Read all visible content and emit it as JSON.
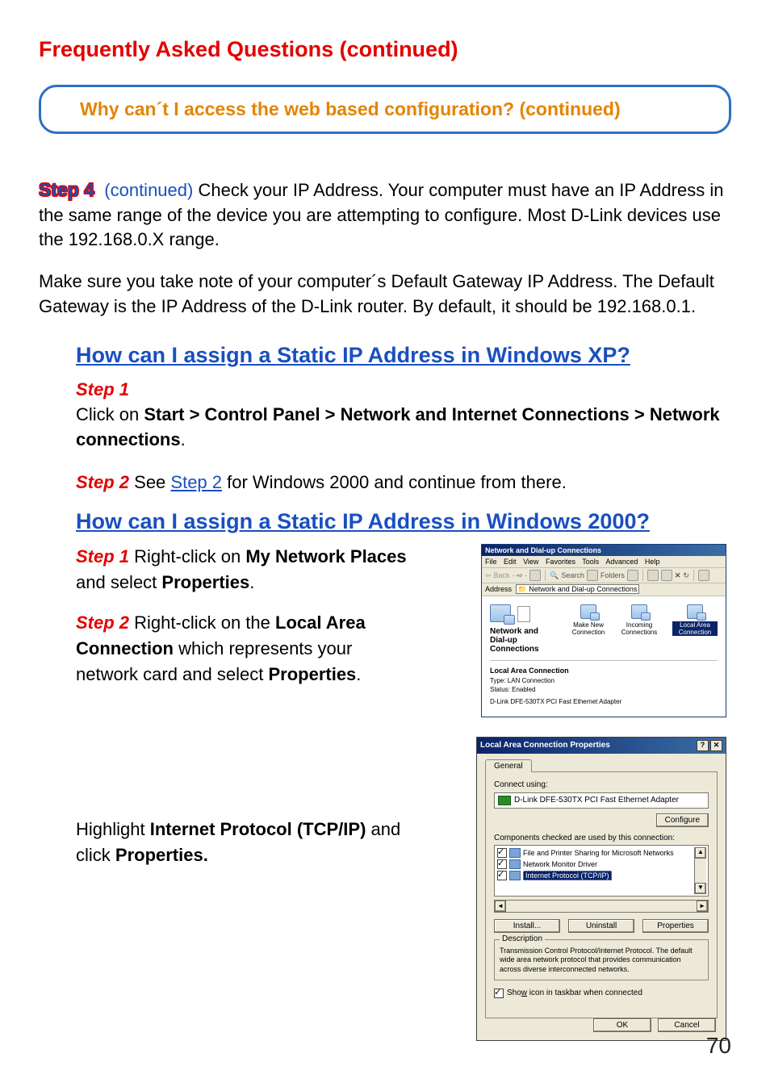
{
  "pageTitle": "Frequently Asked Questions (continued)",
  "questionBox": "Why can´t I access the web based configuration? (continued)",
  "step4": {
    "label": "Step 4",
    "continued": "(continued)",
    "text": " Check your IP Address. Your computer must have an IP Address in the same range of the device you are attempting to configure. Most D-Link devices use the 192.168.0.X range."
  },
  "gatewayText": "Make sure you take note of your computer´s Default Gateway IP Address. The Default Gateway is the IP Address of the D-Link router. By default, it should be 192.168.0.1.",
  "xp": {
    "heading": "How can I assign a Static IP Address in Windows XP?",
    "step1Label": "Step 1",
    "step1Pre": "Click on ",
    "step1Bold": "Start > Control Panel > Network and Internet Connections > Network connections",
    "step1Post": ".",
    "step2Label": "Step 2",
    "step2Pre": " See ",
    "step2Link": "Step 2",
    "step2Post": " for Windows 2000 and continue from there."
  },
  "w2k": {
    "heading": "How can I assign a Static IP Address in Windows 2000?",
    "step1": {
      "label": "Step 1",
      "pre": " Right-click on ",
      "bold1": "My Network Places",
      "mid": " and select ",
      "bold2": "Properties",
      "post": "."
    },
    "step2": {
      "label": "Step 2",
      "pre": " Right-click on the ",
      "bold1": "Local Area Connection",
      "mid": " which represents your network card and select ",
      "bold2": "Properties",
      "post": "."
    },
    "highlight": {
      "pre": "Highlight ",
      "bold1": "Internet Protocol (TCP/IP)",
      "mid": " and click ",
      "bold2": "Properties."
    }
  },
  "explorer": {
    "title": "Network and Dial-up Connections",
    "menus": [
      "File",
      "Edit",
      "View",
      "Favorites",
      "Tools",
      "Advanced",
      "Help"
    ],
    "toolbarBack": "Back",
    "toolbarSearch": "Search",
    "toolbarFolders": "Folders",
    "addressLabel": "Address",
    "addressValue": "Network and Dial-up Connections",
    "ndTitle": "Network and Dial-up Connections",
    "icons": {
      "makeNew": "Make New Connection",
      "incoming": "Incoming Connections",
      "localArea": "Local Area Connection"
    },
    "lac": {
      "title": "Local Area Connection",
      "type": "Type: LAN Connection",
      "status": "Status: Enabled",
      "adapter": "D-Link DFE-530TX PCI Fast Ethernet Adapter"
    }
  },
  "dialog": {
    "title": "Local Area Connection Properties",
    "tab": "General",
    "connectUsing": "Connect using:",
    "adapter": "D-Link DFE-530TX PCI Fast Ethernet Adapter",
    "configure": "Configure",
    "componentsLabel": "Components checked are used by this connection:",
    "components": [
      "File and Printer Sharing for Microsoft Networks",
      "Network Monitor Driver",
      "Internet Protocol (TCP/IP)"
    ],
    "buttons": {
      "install": "Install...",
      "uninstall": "Uninstall",
      "properties": "Properties"
    },
    "descriptionLabel": "Description",
    "descriptionText": "Transmission Control Protocol/Internet Protocol. The default wide area network protocol that provides communication across diverse interconnected networks.",
    "showIcon": "Show icon in taskbar when connected",
    "ok": "OK",
    "cancel": "Cancel"
  },
  "pageNumber": "70"
}
